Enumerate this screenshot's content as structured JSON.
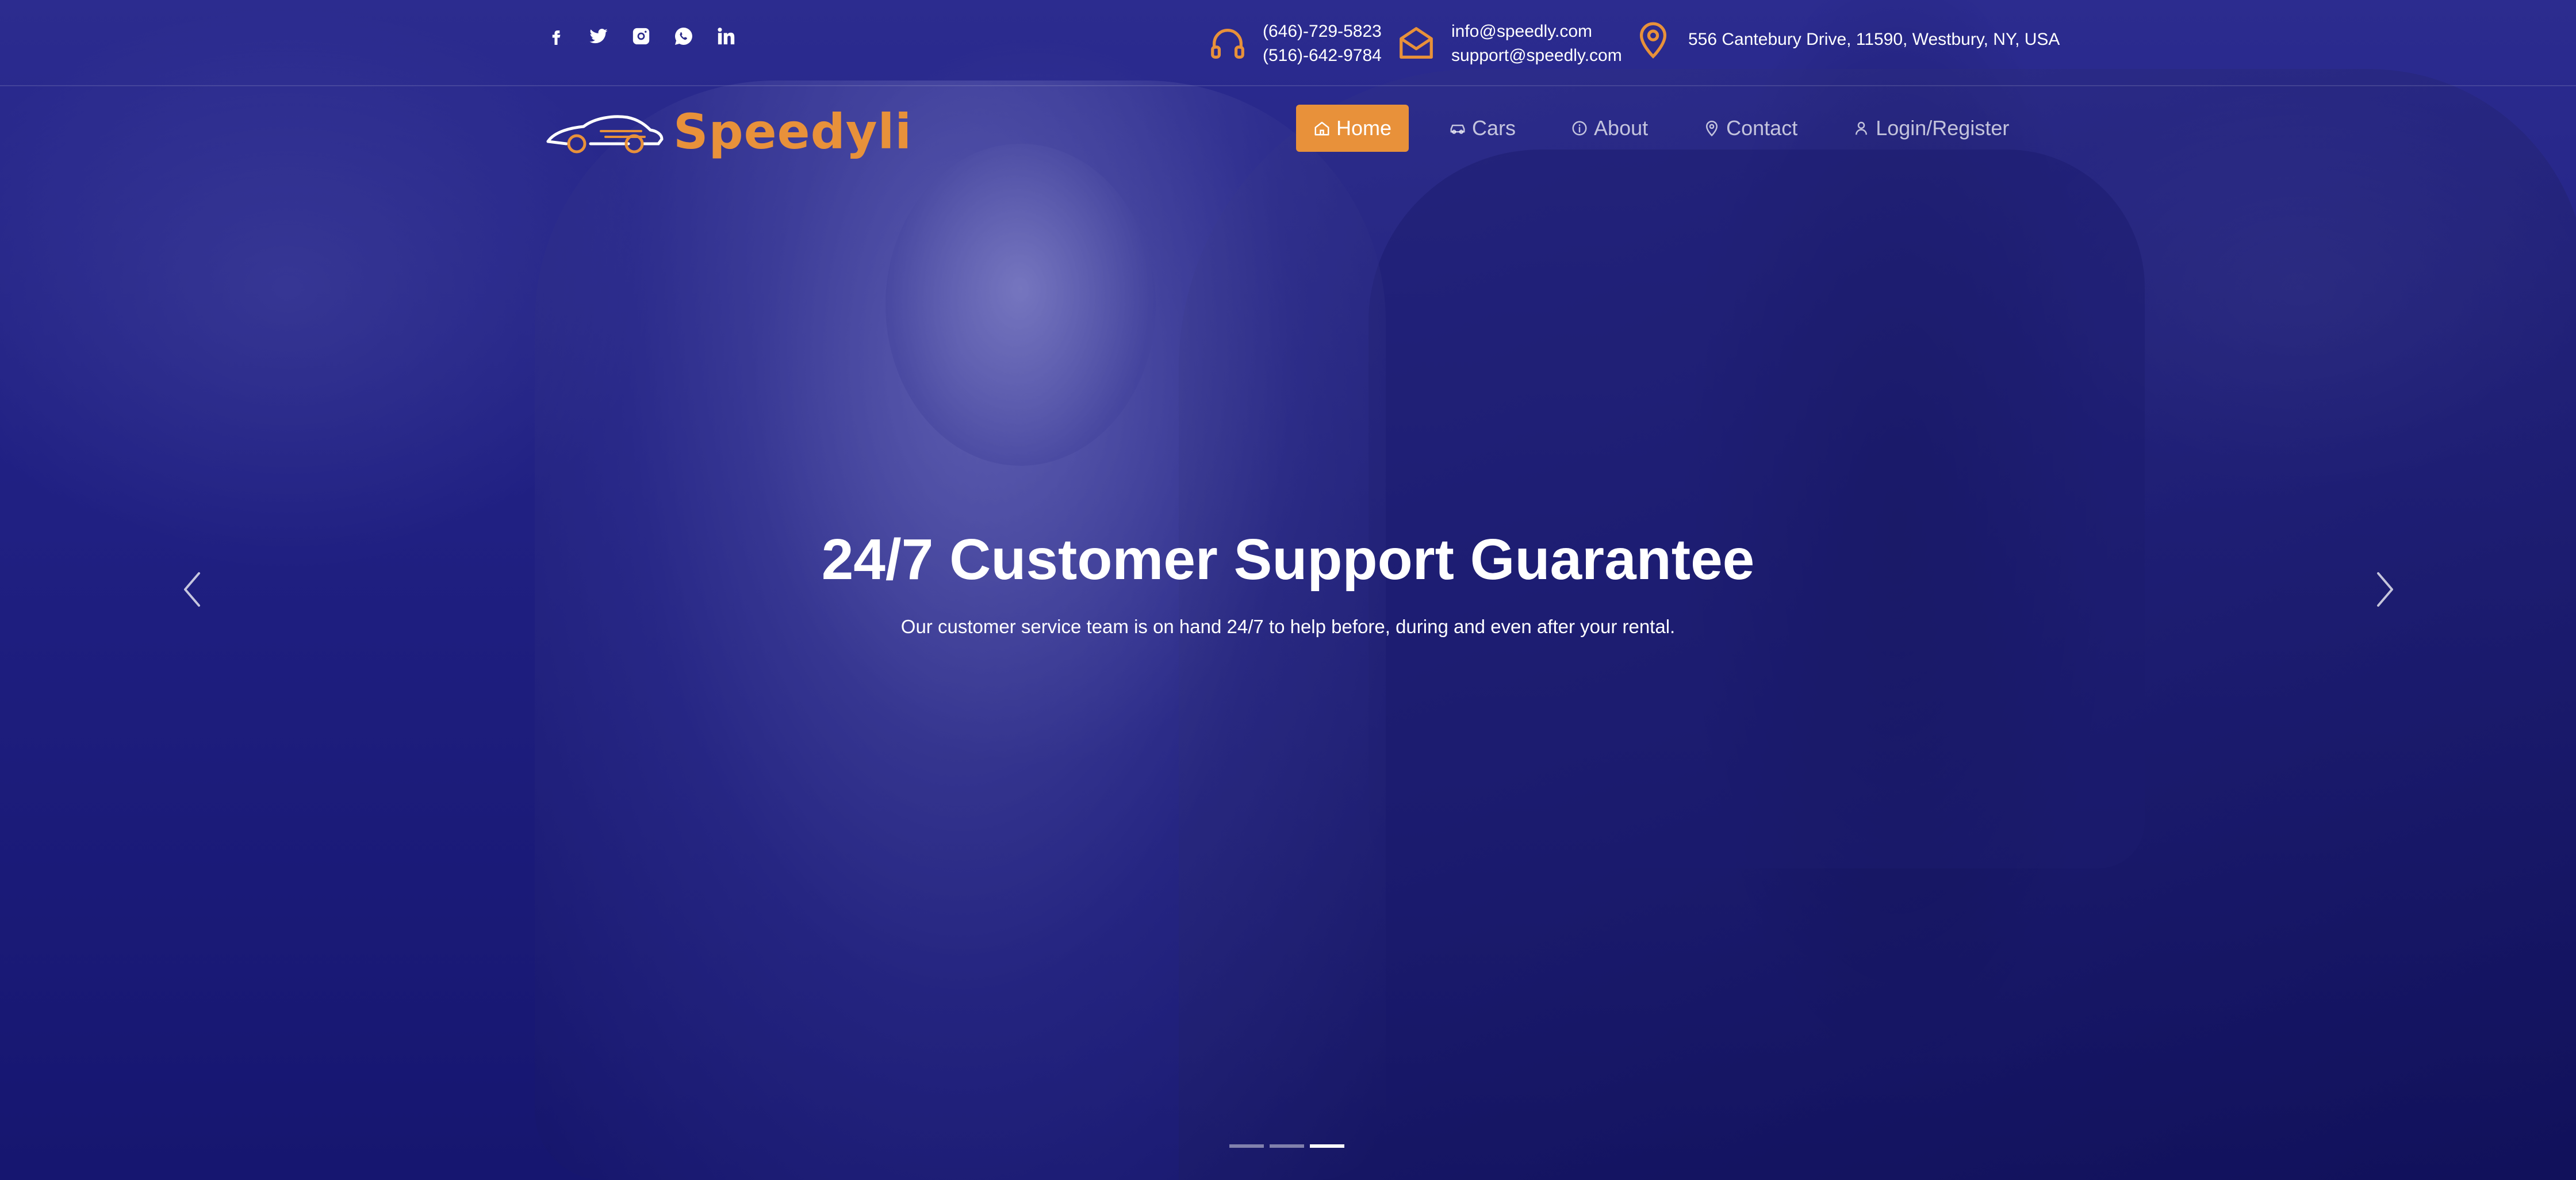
{
  "topbar": {
    "socials": [
      {
        "icon": "facebook-icon",
        "glyph": "f"
      },
      {
        "icon": "twitter-icon",
        "glyph": "t"
      },
      {
        "icon": "instagram-icon",
        "glyph": "o"
      },
      {
        "icon": "whatsapp-icon",
        "glyph": "w"
      },
      {
        "icon": "linkedin-icon",
        "glyph": "in"
      }
    ],
    "phone_1": "(646)-729-5823",
    "phone_2": "(516)-642-9784",
    "email_1": "info@speedly.com",
    "email_2": "support@speedly.com",
    "address": "556 Cantebury Drive, 11590, Westbury, NY, USA"
  },
  "brand": {
    "name": "Speedyli",
    "accent_color": "#e8913a",
    "background_color": "#1b1b78"
  },
  "nav": {
    "items": [
      {
        "label": "Home",
        "icon": "home-icon",
        "active": true
      },
      {
        "label": "Cars",
        "icon": "car-icon",
        "active": false
      },
      {
        "label": "About",
        "icon": "info-icon",
        "active": false
      },
      {
        "label": "Contact",
        "icon": "location-pin-icon",
        "active": false
      },
      {
        "label": "Login/Register",
        "icon": "user-icon",
        "active": false
      }
    ]
  },
  "hero": {
    "title": "24/7 Customer Support Guarantee",
    "subtitle": "Our customer service team is on hand 24/7 to help before, during and even after your rental.",
    "slide_count": 3,
    "active_slide": 3
  }
}
